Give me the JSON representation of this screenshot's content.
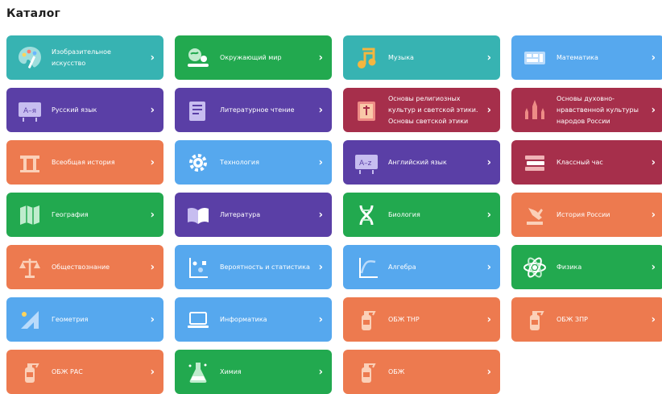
{
  "title": "Каталог",
  "chevron": "›",
  "cards": [
    {
      "label": "Изобразительное искусство",
      "color": "#37b3b2",
      "icon": "palette-icon"
    },
    {
      "label": "Окружающий мир",
      "color": "#22a94f",
      "icon": "world-icon"
    },
    {
      "label": "Музыка",
      "color": "#37b3b2",
      "icon": "music-note-icon"
    },
    {
      "label": "Математика",
      "color": "#56a8ee",
      "icon": "math-icon"
    },
    {
      "label": "Русский язык",
      "color": "#5a3fa6",
      "icon": "board-icon"
    },
    {
      "label": "Литературное чтение",
      "color": "#5a3fa6",
      "icon": "book-icon"
    },
    {
      "label": "Основы религиозных культур и светской этики. Основы светской этики",
      "color": "#a62f4b",
      "icon": "book-icon"
    },
    {
      "label": "Основы духовно-нравственной культуры народов России",
      "color": "#a62f4b",
      "icon": "kremlin-icon"
    },
    {
      "label": "Всеобщая история",
      "color": "#ed7a4f",
      "icon": "column-icon"
    },
    {
      "label": "Технология",
      "color": "#56a8ee",
      "icon": "gear-icon"
    },
    {
      "label": "Английский язык",
      "color": "#5a3fa6",
      "icon": "board-icon"
    },
    {
      "label": "Классный час",
      "color": "#a62f4b",
      "icon": "books-stack-icon"
    },
    {
      "label": "География",
      "color": "#22a94f",
      "icon": "map-icon"
    },
    {
      "label": "Литература",
      "color": "#5a3fa6",
      "icon": "open-book-icon"
    },
    {
      "label": "Биология",
      "color": "#22a94f",
      "icon": "dna-icon"
    },
    {
      "label": "История России",
      "color": "#ed7a4f",
      "icon": "monument-icon"
    },
    {
      "label": "Обществознание",
      "color": "#ed7a4f",
      "icon": "scales-icon"
    },
    {
      "label": "Вероятность и статистика",
      "color": "#56a8ee",
      "icon": "plot-icon"
    },
    {
      "label": "Алгебра",
      "color": "#56a8ee",
      "icon": "graph-icon"
    },
    {
      "label": "Физика",
      "color": "#22a94f",
      "icon": "atom-icon"
    },
    {
      "label": "Геометрия",
      "color": "#56a8ee",
      "icon": "triangle-ruler-icon"
    },
    {
      "label": "Информатика",
      "color": "#56a8ee",
      "icon": "laptop-icon"
    },
    {
      "label": "ОБЖ ТНР",
      "color": "#ed7a4f",
      "icon": "extinguisher-icon"
    },
    {
      "label": "ОБЖ ЗПР",
      "color": "#ed7a4f",
      "icon": "extinguisher-icon"
    },
    {
      "label": "ОБЖ РАС",
      "color": "#ed7a4f",
      "icon": "extinguisher-icon"
    },
    {
      "label": "Химия",
      "color": "#22a94f",
      "icon": "flask-icon"
    },
    {
      "label": "ОБЖ",
      "color": "#ed7a4f",
      "icon": "extinguisher-icon"
    }
  ]
}
